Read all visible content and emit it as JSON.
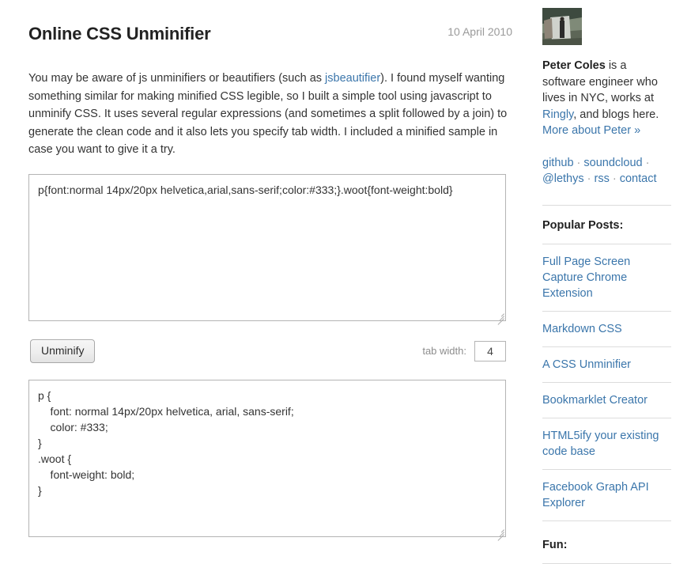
{
  "post": {
    "title": "Online CSS Unminifier",
    "date": "10 April 2010",
    "body_part_1": "You may be aware of js unminifiers or beautifiers (such as ",
    "body_link": "jsbeautifier",
    "body_part_2": "). I found myself wanting something similar for making minified CSS legible, so I built a simple tool using javascript to unminify CSS. It uses several regular expressions (and sometimes a split followed by a join) to generate the clean code and it also lets you specify tab width. I included a minified sample in case you want to give it a try."
  },
  "tool": {
    "input_value": "p{font:normal 14px/20px helvetica,arial,sans-serif;color:#333;}.woot{font-weight:bold}",
    "unminify_label": "Unminify",
    "tab_width_label": "tab width:",
    "tab_width_value": "4",
    "output_value": "p {\n    font: normal 14px/20px helvetica, arial, sans-serif;\n    color: #333;\n}\n.woot {\n    font-weight: bold;\n}"
  },
  "sidebar": {
    "avatar_alt": "avatar-photo",
    "bio_name": "Peter Coles",
    "bio_text_1": " is a software engineer who lives in NYC, works at ",
    "bio_link_company": "Ringly",
    "bio_text_2": ", and blogs here. ",
    "bio_link_more": "More about Peter »",
    "social_links": [
      "github",
      "soundcloud",
      "@lethys",
      "rss",
      "contact"
    ],
    "social_separator": " · ",
    "popular_heading": "Popular Posts:",
    "popular_posts": [
      "Full Page Screen Capture Chrome Extension",
      "Markdown CSS",
      "A CSS Unminifier",
      "Bookmarklet Creator",
      "HTML5ify your existing code base",
      "Facebook Graph API Explorer"
    ],
    "fun_heading": "Fun:"
  },
  "colors": {
    "link": "#3b76ab",
    "text": "#333333",
    "muted": "#9a9a9a",
    "divider": "#dcdcdc",
    "border": "#b4b4b4"
  }
}
